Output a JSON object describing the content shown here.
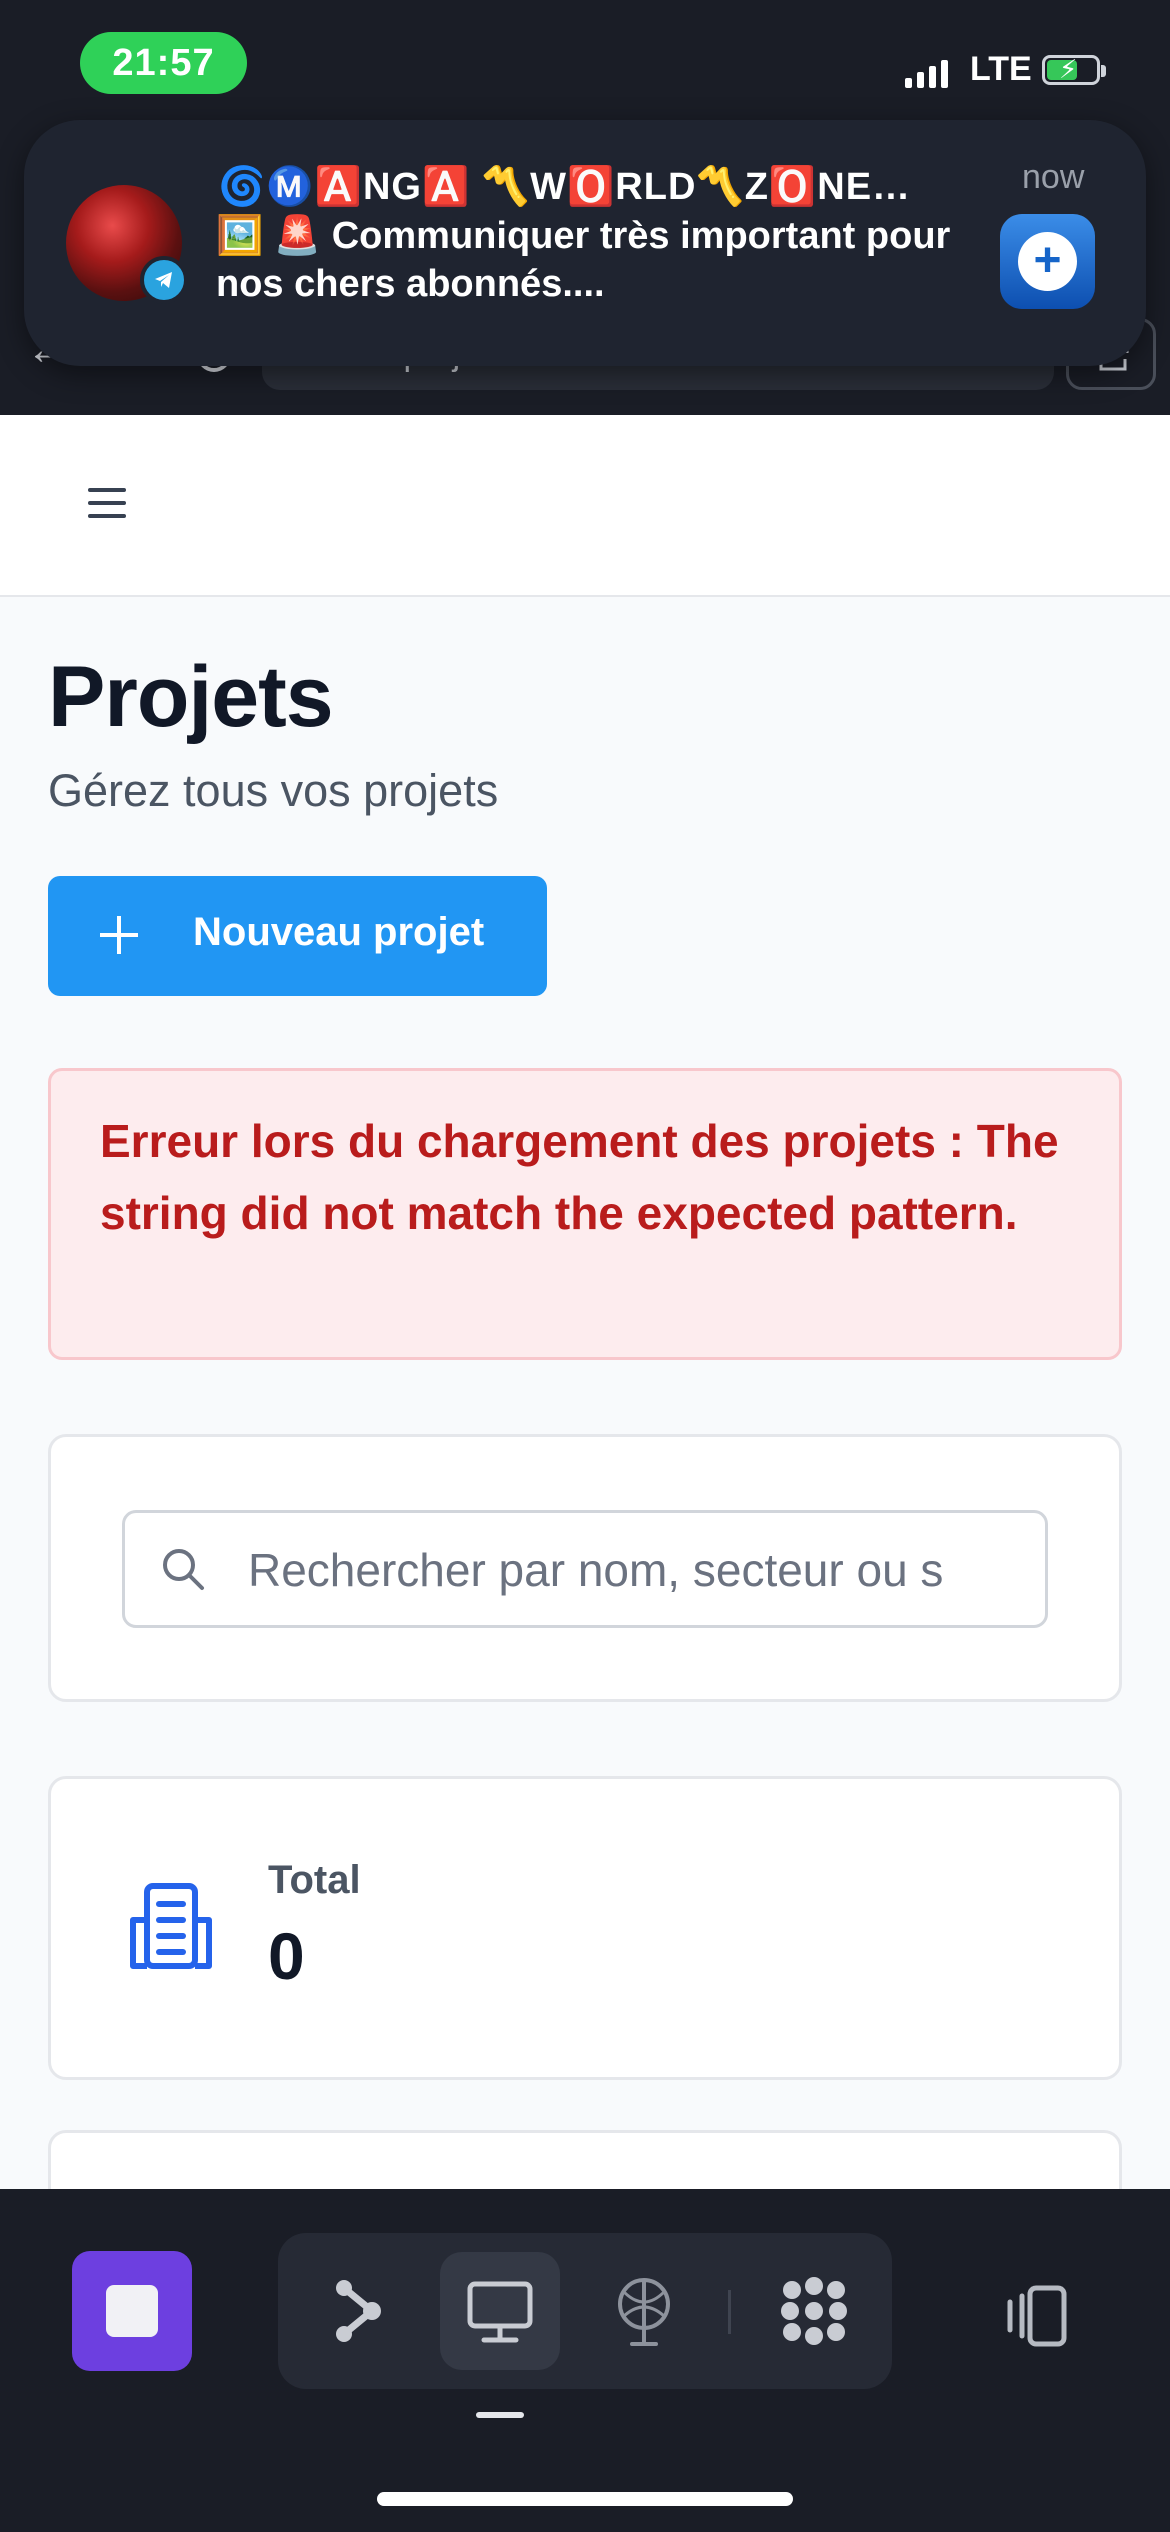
{
  "status_bar": {
    "time": "21:57",
    "network": "LTE",
    "battery_charging": true
  },
  "notification": {
    "title": "🌀Ⓜ️🅰️NG🅰️ 〽️W🅾️RLD〽️Z🅾️NE…",
    "body": "🖼️ 🚨 Communiquer très important pour nos chers abonnés....",
    "time": "now",
    "source_badge_icon": "telegram-icon",
    "app_icon": "plus-circle-icon"
  },
  "browser": {
    "url": "/admin/projets"
  },
  "page": {
    "title": "Projets",
    "subtitle": "Gérez tous vos projets",
    "new_button_label": "Nouveau projet",
    "error_message": "Erreur lors du chargement des projets : The string did not match the expected pattern.",
    "search_placeholder": "Rechercher par nom, secteur ou s",
    "stats": {
      "total_label": "Total",
      "total_value": "0"
    }
  },
  "dock": {
    "items": [
      "stop-square-icon",
      "share-network-icon",
      "desktop-icon",
      "antenna-icon",
      "apps-grid-icon",
      "panels-icon"
    ],
    "active_item": "desktop-icon"
  },
  "colors": {
    "primary_button": "#2196f3",
    "error_text": "#b91c1c",
    "error_bg": "#fdecee",
    "dock_accent": "#6d3fe0",
    "time_pill": "#2fd158"
  }
}
